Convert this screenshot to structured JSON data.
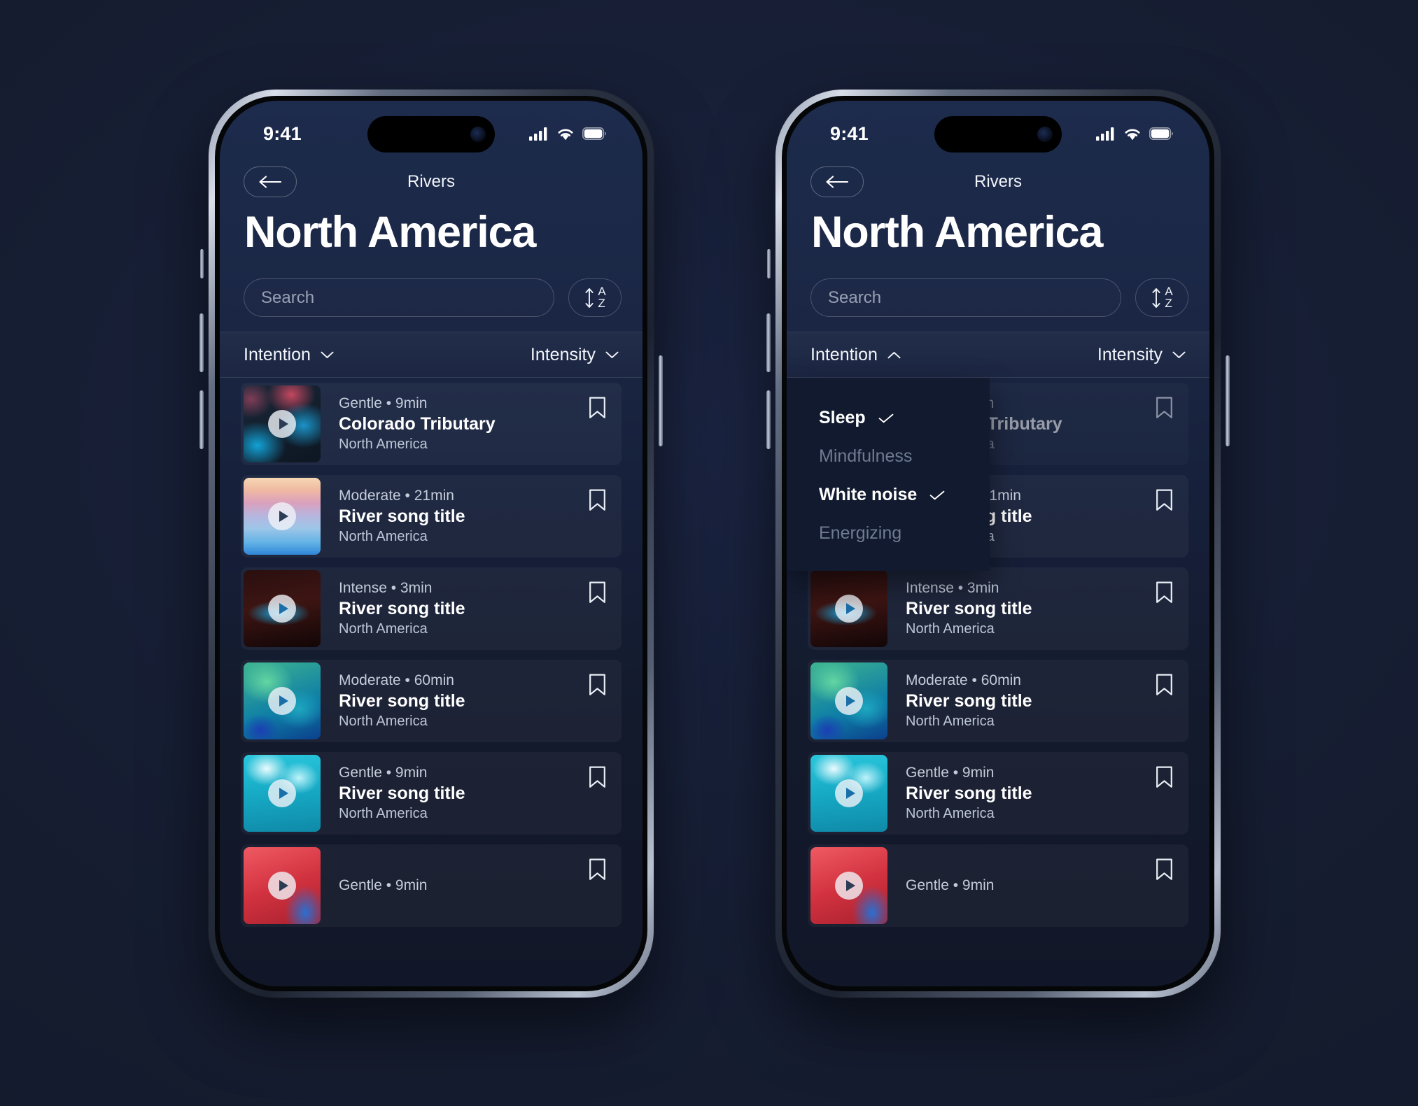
{
  "status_bar": {
    "time": "9:41",
    "cellular_icon": "cellular-signal-icon",
    "wifi_icon": "wifi-icon",
    "battery_icon": "battery-icon"
  },
  "nav": {
    "back_icon": "arrow-left-icon",
    "title": "Rivers"
  },
  "header": {
    "page_title": "North America"
  },
  "search": {
    "placeholder": "Search",
    "value": "",
    "sort_icon": "sort-az-icon",
    "sort_a": "A",
    "sort_z": "Z"
  },
  "filters": {
    "intention": {
      "label": "Intention",
      "chevron_closed": "chevron-down-icon",
      "chevron_open": "chevron-up-icon"
    },
    "intensity": {
      "label": "Intensity",
      "chevron": "chevron-down-icon"
    }
  },
  "intention_menu": {
    "items": [
      {
        "label": "Sleep",
        "selected": true
      },
      {
        "label": "Mindfulness",
        "selected": false
      },
      {
        "label": "White noise",
        "selected": true
      },
      {
        "label": "Energizing",
        "selected": false
      }
    ]
  },
  "tracks": [
    {
      "meta": "Gentle • 9min",
      "title": "Colorado Tributary",
      "region": "North America",
      "bookmark_icon": "bookmark-icon",
      "play_icon": "play-icon"
    },
    {
      "meta": "Moderate • 21min",
      "title": "River song title",
      "region": "North America",
      "bookmark_icon": "bookmark-icon",
      "play_icon": "play-icon"
    },
    {
      "meta": "Intense • 3min",
      "title": "River song title",
      "region": "North America",
      "bookmark_icon": "bookmark-icon",
      "play_icon": "play-icon"
    },
    {
      "meta": "Moderate • 60min",
      "title": "River song title",
      "region": "North America",
      "bookmark_icon": "bookmark-icon",
      "play_icon": "play-icon"
    },
    {
      "meta": "Gentle • 9min",
      "title": "River song title",
      "region": "North America",
      "bookmark_icon": "bookmark-icon",
      "play_icon": "play-icon"
    },
    {
      "meta": "Gentle • 9min",
      "title": "",
      "region": "",
      "bookmark_icon": "bookmark-icon",
      "play_icon": "play-icon"
    }
  ],
  "colors": {
    "page_background": "#161d31",
    "screen_top": "#1d2b4c",
    "screen_bottom": "#111728",
    "menu_background": "#111a2e",
    "text_primary": "#ffffff",
    "text_muted": "#6f7b91",
    "row_background": "rgba(255,255,255,.045)"
  }
}
